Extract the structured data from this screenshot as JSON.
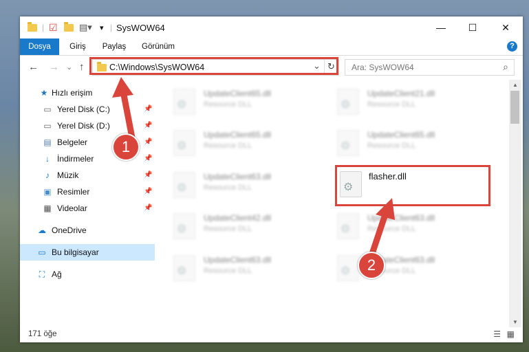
{
  "window": {
    "title": "SysWOW64",
    "minimize_glyph": "—",
    "maximize_glyph": "☐",
    "close_glyph": "✕"
  },
  "ribbon": {
    "tabs": [
      {
        "label": "Dosya"
      },
      {
        "label": "Giriş"
      },
      {
        "label": "Paylaş"
      },
      {
        "label": "Görünüm"
      }
    ],
    "help_glyph": "?"
  },
  "address": {
    "path": "C:\\Windows\\SysWOW64",
    "dropdown_glyph": "⌄",
    "refresh_glyph": "↻"
  },
  "search": {
    "placeholder": "Ara: SysWOW64",
    "icon_glyph": "⌕"
  },
  "nav": {
    "back_glyph": "←",
    "forward_glyph": "→",
    "recent_glyph": "⌄",
    "up_glyph": "↑"
  },
  "sidebar": {
    "items": [
      {
        "label": "Hızlı erişim",
        "icon": "★"
      },
      {
        "label": "Yerel Disk (C:)",
        "icon": "▭"
      },
      {
        "label": "Yerel Disk (D:)",
        "icon": "▭"
      },
      {
        "label": "Belgeler",
        "icon": "▤"
      },
      {
        "label": "İndirmeler",
        "icon": "↓"
      },
      {
        "label": "Müzik",
        "icon": "♪"
      },
      {
        "label": "Resimler",
        "icon": "▣"
      },
      {
        "label": "Videolar",
        "icon": "▦"
      },
      {
        "label": "OneDrive",
        "icon": "☁"
      },
      {
        "label": "Bu bilgisayar",
        "icon": "▭"
      },
      {
        "label": "Ağ",
        "icon": "⛶"
      }
    ],
    "pin_glyph": "📌"
  },
  "files": [
    {
      "name": "UpdateClient65.dll",
      "type": "Resource DLL"
    },
    {
      "name": "UpdateClient21.dll",
      "type": "Resource DLL"
    },
    {
      "name": "UpdateClient65.dll",
      "type": "Resource DLL"
    },
    {
      "name": "UpdateClient65.dll",
      "type": "Resource DLL"
    },
    {
      "name": "UpdateClient63.dll",
      "type": "Resource DLL"
    },
    {
      "name": "flasher.dll",
      "type": ""
    },
    {
      "name": "UpdateClient42.dll",
      "type": "Resource DLL"
    },
    {
      "name": "UpdateClient63.dll",
      "type": "Resource DLL"
    },
    {
      "name": "UpdateClient63.dll",
      "type": "Resource DLL"
    },
    {
      "name": "UpdateClient63.dll",
      "type": "Resource DLL"
    }
  ],
  "status": {
    "count": "171 öğe"
  },
  "annotations": {
    "step1": "1",
    "step2": "2"
  },
  "colors": {
    "accent": "#1979ca",
    "highlight": "#d9443b",
    "selection": "#cce8ff"
  }
}
